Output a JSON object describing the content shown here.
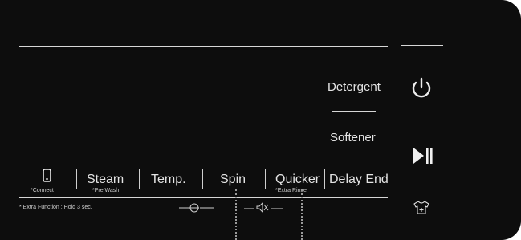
{
  "control_panel": {
    "buttons": [
      {
        "id": "connect",
        "label": "",
        "sublabel": "*Connect",
        "icon": "phone-icon"
      },
      {
        "id": "steam",
        "label": "Steam",
        "sublabel": "*Pre Wash"
      },
      {
        "id": "temp",
        "label": "Temp.",
        "sublabel": ""
      },
      {
        "id": "spin",
        "label": "Spin",
        "sublabel": ""
      },
      {
        "id": "quicker",
        "label": "Quicker",
        "sublabel": "*Extra Rinse"
      },
      {
        "id": "delay_end",
        "label": "Delay End",
        "sublabel": ""
      }
    ],
    "extra_function_note": "* Extra Function : Hold 3 sec.",
    "indicators": {
      "detergent": "Detergent",
      "softener": "Softener"
    },
    "right_column": {
      "power_icon": "power-icon",
      "start_pause_icon": "play-pause-icon",
      "shirt_icon": "shirt-plus-icon"
    },
    "lock_icon": "child-lock-icon",
    "mute_icon": "mute-icon",
    "colors": {
      "panel": "#0d0d0d",
      "text": "#e4e4e4",
      "line": "#d6d6d6"
    }
  }
}
